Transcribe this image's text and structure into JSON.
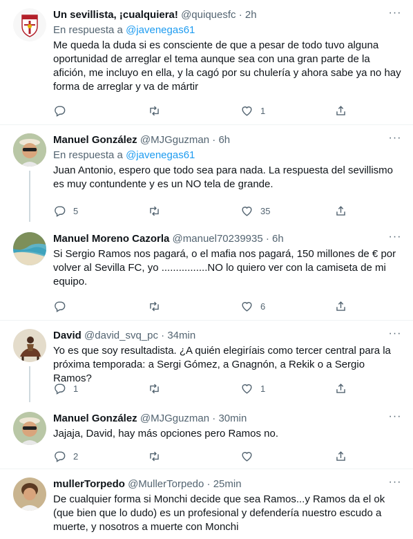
{
  "reply_prefix": "En respuesta a",
  "more_glyph": "···",
  "tweets": [
    {
      "name": "Un sevillista, ¡cualquiera!",
      "handle": "@quiquesfc",
      "dot": "·",
      "time": "2h",
      "reply_to": "@javenegas61",
      "text": "Me queda la duda si es consciente de que a pesar de todo tuvo alguna oportunidad de arreglar el tema aunque sea con una gran parte de la afición, me incluyo en ella, y la cagó por su chulería y ahora sabe ya no hay forma de arreglar y va de mártir",
      "replies": "",
      "retweets": "",
      "likes": "1"
    },
    {
      "name": "Manuel González",
      "handle": "@MJGguzman",
      "dot": "·",
      "time": "6h",
      "reply_to": "@javenegas61",
      "text": "Juan Antonio, espero que todo sea para nada. La respuesta del sevillismo es muy contundente y es un NO tela de grande.",
      "replies": "5",
      "retweets": "",
      "likes": "35"
    },
    {
      "name": "Manuel Moreno Cazorla",
      "handle": "@manuel70239935",
      "dot": "·",
      "time": "6h",
      "text": "Si Sergio Ramos nos pagará, o el mafia nos pagará, 150 millones de € por volver al Sevilla FC, yo ................NO lo quiero ver con la camiseta de mi equipo.",
      "replies": "",
      "retweets": "",
      "likes": "6"
    },
    {
      "name": "David",
      "handle": "@david_svq_pc",
      "dot": "·",
      "time": "34min",
      "text": "Yo es que soy resultadista. ¿A quién elegiríais como tercer central para la próxima temporada: a Sergi Gómez, a Gnagnón, a Rekik o a Sergio Ramos?",
      "replies": "1",
      "retweets": "",
      "likes": "1"
    },
    {
      "name": "Manuel González",
      "handle": "@MJGguzman",
      "dot": "·",
      "time": "30min",
      "text": "Jajaja, David, hay más opciones pero Ramos no.",
      "replies": "2",
      "retweets": "",
      "likes": ""
    },
    {
      "name": "mullerTorpedo",
      "handle": "@MullerTorpedo",
      "dot": "·",
      "time": "25min",
      "text": "De cualquier forma si Monchi decide que sea Ramos...y Ramos da el ok (que bien que lo dudo) es un profesional y defendería nuestro escudo a muerte, y nosotros a muerte con Monchi"
    }
  ]
}
